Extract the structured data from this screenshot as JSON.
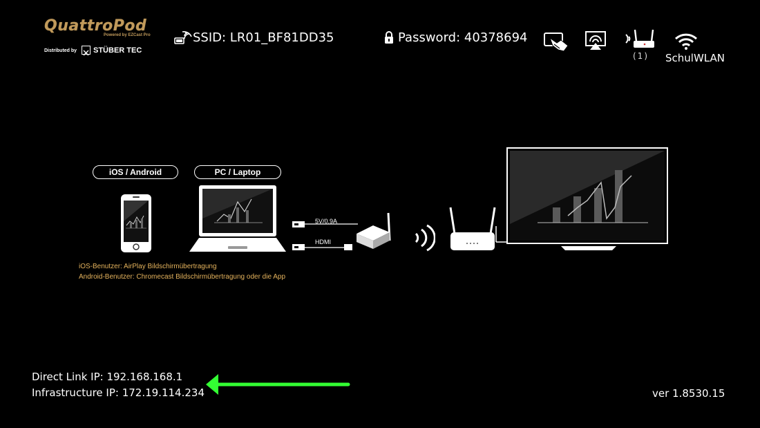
{
  "brand": {
    "name": "QuattroPod",
    "powered_by": "Powered by EZCast Pro",
    "distributed_prefix": "Distributed by",
    "distributor": "STÜBER TEC"
  },
  "network": {
    "ssid_label": "SSID: LR01_BF81DD35",
    "password_label": "Password: 40378694",
    "router_count": "(1)",
    "wifi_name": "SchulWLAN"
  },
  "icons": {
    "ssid": "cast-wifi-icon",
    "lock": "lock-icon",
    "settings": "settings-hand-icon",
    "airplay": "airplay-icon",
    "router": "router-icon",
    "wifi": "wifi-icon"
  },
  "diagram": {
    "ios_label": "iOS / Android",
    "pc_label": "PC / Laptop",
    "usb_label": "5V/0.9A",
    "hdmi_label": "HDMI",
    "note_ios": "iOS-Benutzer: AirPlay Bildschirmübertragung",
    "note_android": "Android-Benutzer: Chromecast Bildschirmübertragung oder die App"
  },
  "footer": {
    "direct_link": "Direct Link IP: 192.168.168.1",
    "infrastructure": "Infrastructure IP: 172.19.114.234",
    "version": "ver 1.8530.15"
  },
  "colors": {
    "background": "#000000",
    "brand_gold": "#c19a5b",
    "note_orange": "#e5b35d",
    "arrow_green": "#33ff33"
  }
}
